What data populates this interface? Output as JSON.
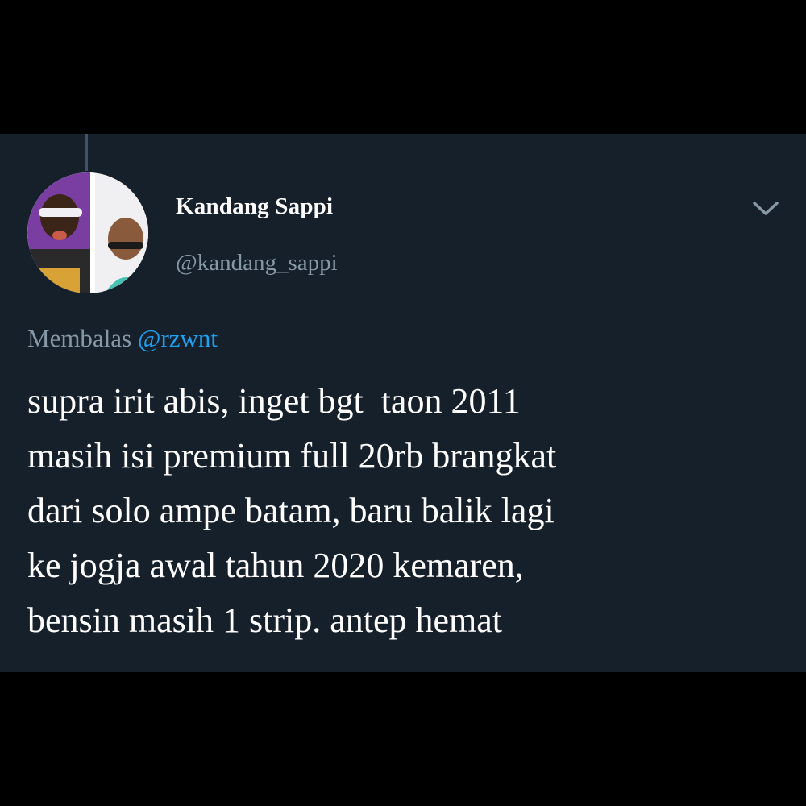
{
  "tweet": {
    "author": {
      "display_name": "Kandang Sappi",
      "handle": "@kandang_sappi",
      "avatar_icon": "profile-photo-icon"
    },
    "menu_icon": "chevron-down-icon",
    "reply": {
      "prefix": "Membalas",
      "target": "@rzwnt"
    },
    "text_lines": [
      "supra irit abis, inget bgt  taon 2011",
      "masih isi premium full 20rb brangkat",
      "dari solo ampe batam, baru balik lagi",
      "ke jogja awal tahun 2020 kemaren,",
      "bensin masih 1 strip. antep hemat"
    ]
  },
  "colors": {
    "page_background": "#000000",
    "card_background": "#16202b",
    "primary_text": "#ffffff",
    "secondary_text": "#8899a6",
    "link": "#1da1f2",
    "thread_line": "#3d5466"
  }
}
